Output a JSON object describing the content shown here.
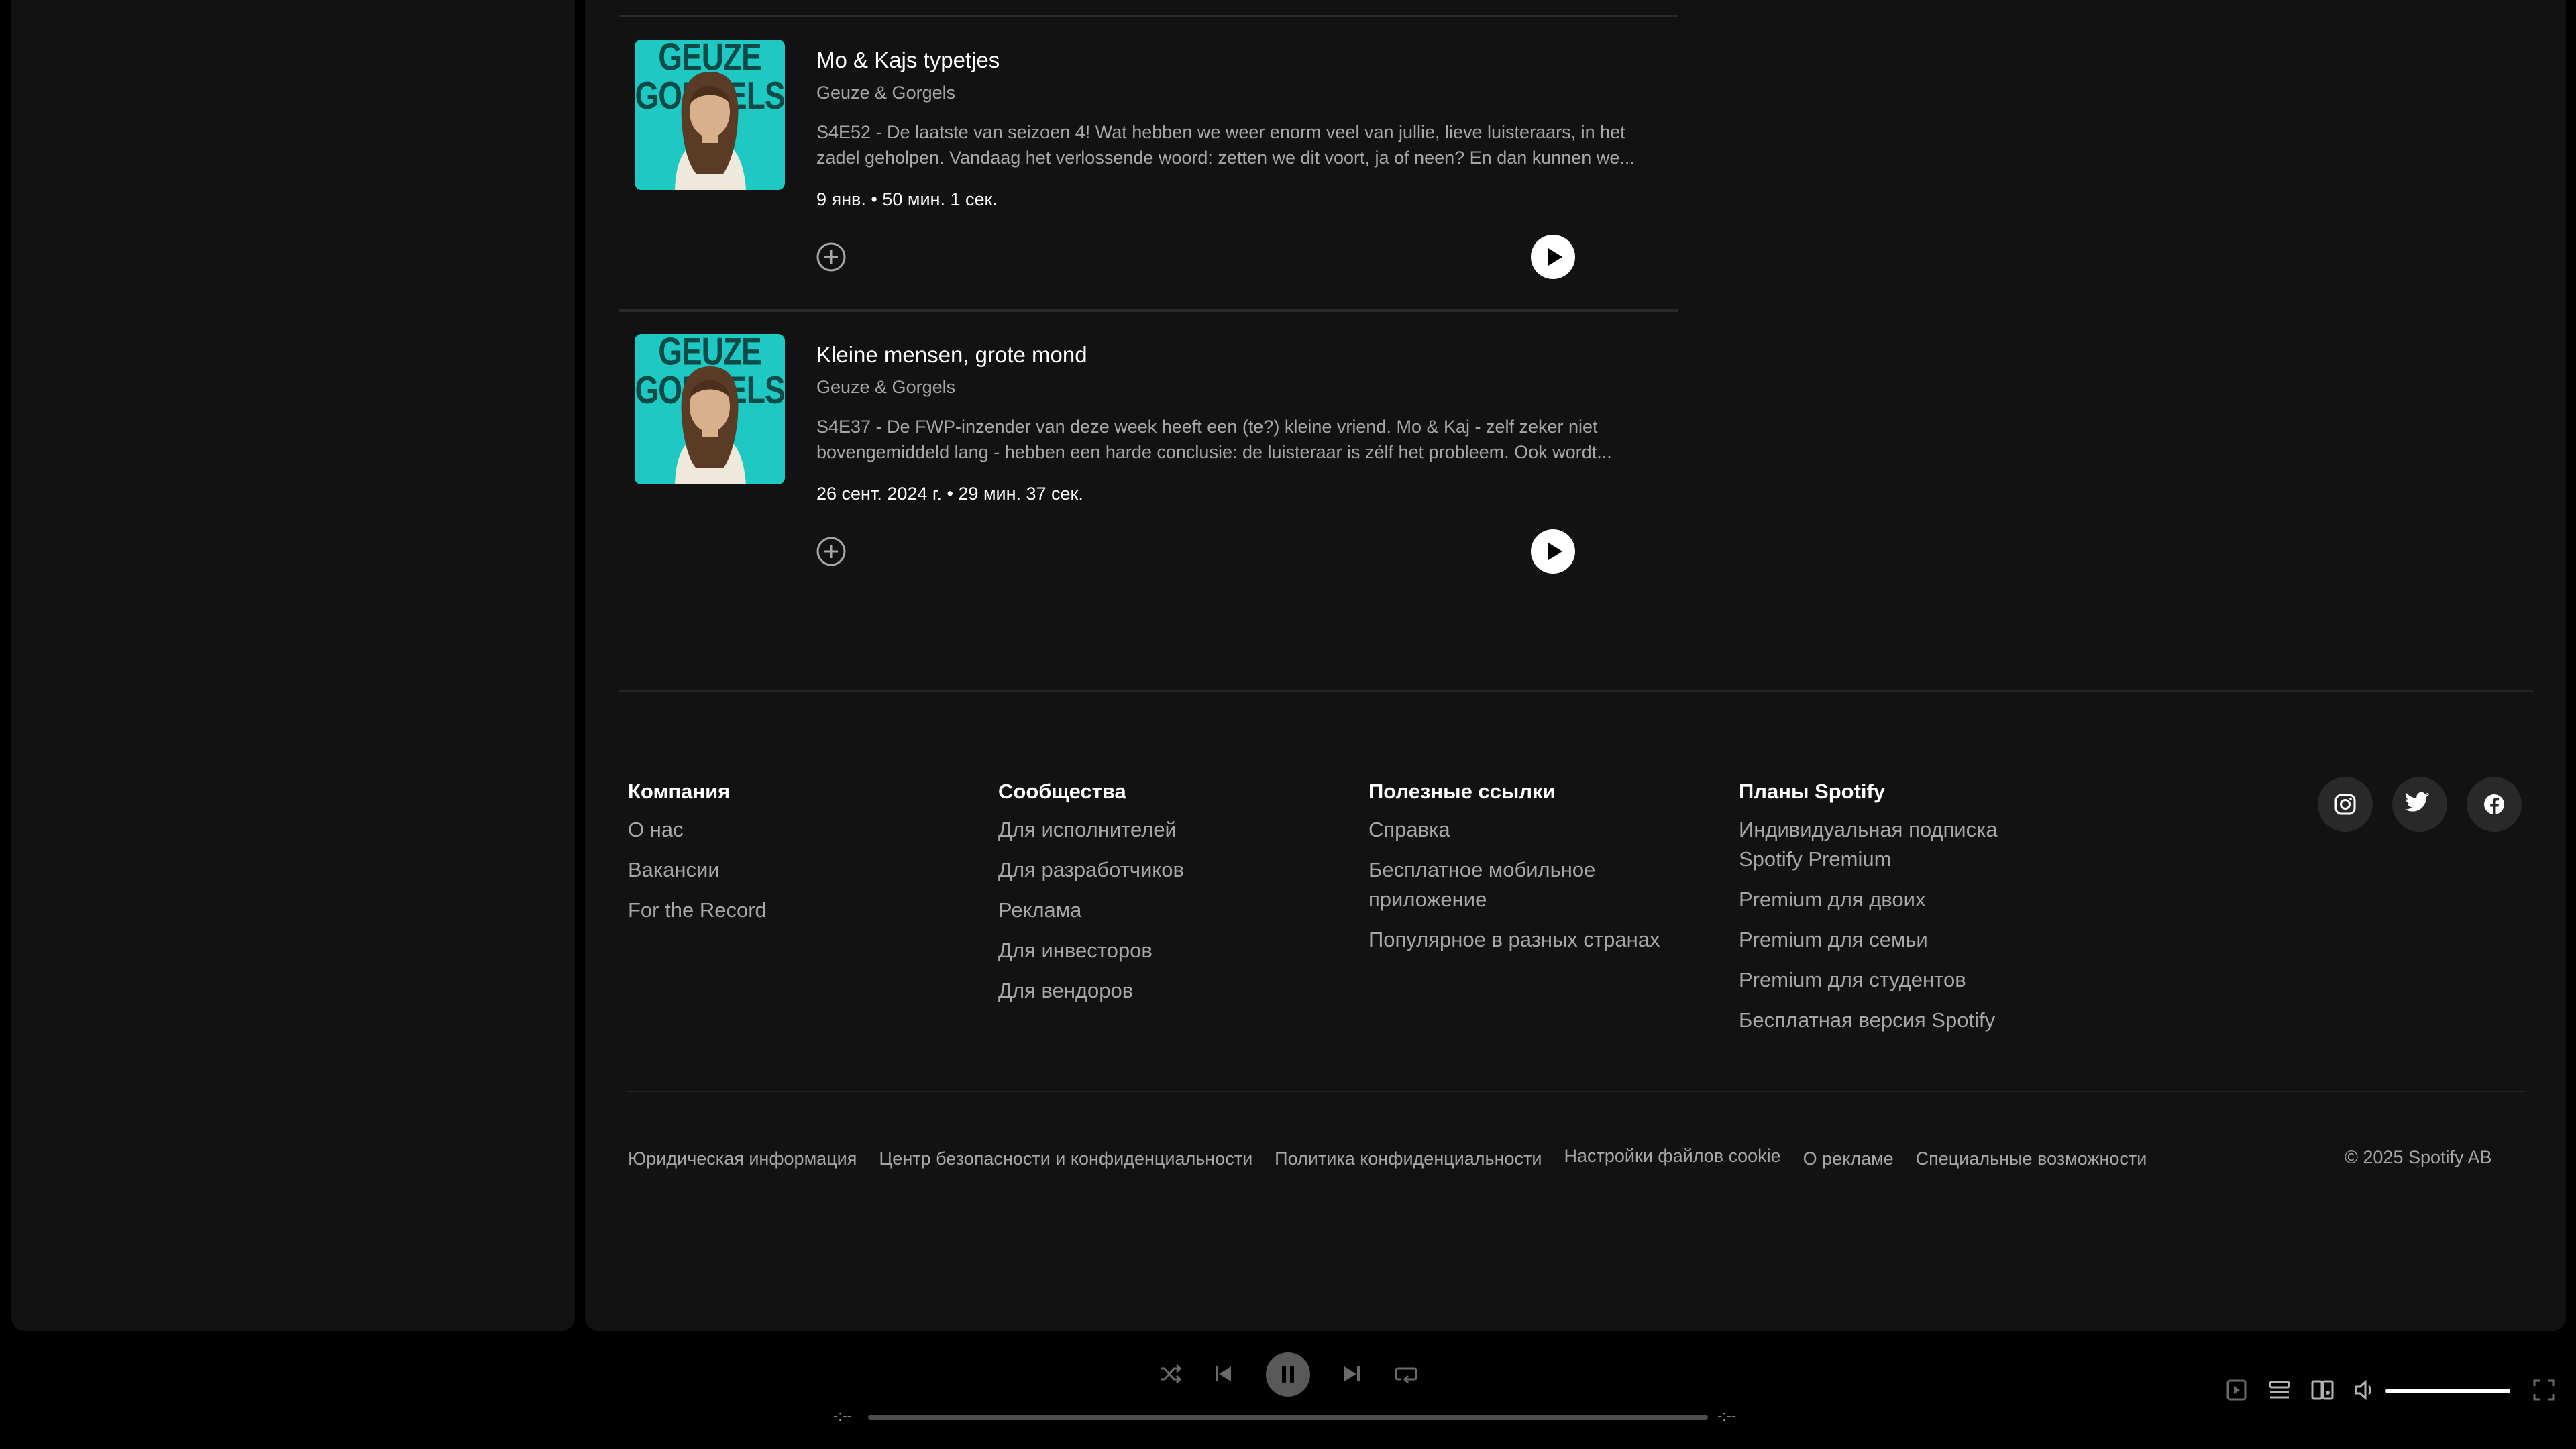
{
  "episodes": [
    {
      "cover_text": "GEUZE GORGELS",
      "title": "Mo & Kajs typetjes",
      "show": "Geuze & Gorgels",
      "description": "S4E52 - De laatste van seizoen 4! Wat hebben we weer enorm veel van jullie, lieve luisteraars, in het zadel geholpen. Vandaag het verlossende woord: zetten we dit voort, ja of neen? En dan kunnen we...",
      "meta": "9 янв. • 50 мин. 1 сек."
    },
    {
      "cover_text": "GEUZE GORGELS",
      "title": "Kleine mensen, grote mond",
      "show": "Geuze & Gorgels",
      "description": "S4E37 - De FWP-inzender van deze week heeft een (te?) kleine vriend. Mo & Kaj - zelf zeker niet bovengemiddeld lang - hebben een harde conclusie: de luisteraar is zélf het probleem. Ook wordt...",
      "meta": "26 сент. 2024 г. • 29 мин. 37 сек."
    }
  ],
  "footer": {
    "columns": [
      {
        "heading": "Компания",
        "links": [
          "О нас",
          "Вакансии",
          "For the Record"
        ]
      },
      {
        "heading": "Сообщества",
        "links": [
          "Для исполнителей",
          "Для разработчиков",
          "Реклама",
          "Для инвесторов",
          "Для вендоров"
        ]
      },
      {
        "heading": "Полезные ссылки",
        "links": [
          "Справка",
          "Бесплатное мобильное приложение",
          "Популярное в разных странах"
        ]
      },
      {
        "heading": "Планы Spotify",
        "links": [
          "Индивидуальная подписка Spotify Premium",
          "Premium для двоих",
          "Premium для семьи",
          "Premium для студентов",
          "Бесплатная версия Spotify"
        ]
      }
    ],
    "social_icons": [
      "instagram-icon",
      "twitter-icon",
      "facebook-icon"
    ],
    "legal_links": [
      "Юридическая информация",
      "Центр безопасности и конфиденциальности",
      "Политика конфиденциальности",
      "Настройки файлов cookie",
      "О рекламе",
      "Специальные возможности"
    ],
    "copyright": "© 2025 Spotify AB"
  },
  "player": {
    "time_elapsed": "-:--",
    "time_total": "-:--",
    "progress_fraction": 0,
    "volume_fraction": 1,
    "controls": [
      "shuffle-icon",
      "previous-icon",
      "pause-icon",
      "next-icon",
      "repeat-icon"
    ],
    "right_icons": [
      "now-playing-view-icon",
      "queue-icon",
      "connect-device-icon",
      "volume-icon",
      "fullscreen-icon"
    ]
  },
  "colors": {
    "background": "#000000",
    "panel": "#121212",
    "text_primary": "#ffffff",
    "text_secondary": "#a7a7a7",
    "cover_teal": "#1ec9c3"
  }
}
